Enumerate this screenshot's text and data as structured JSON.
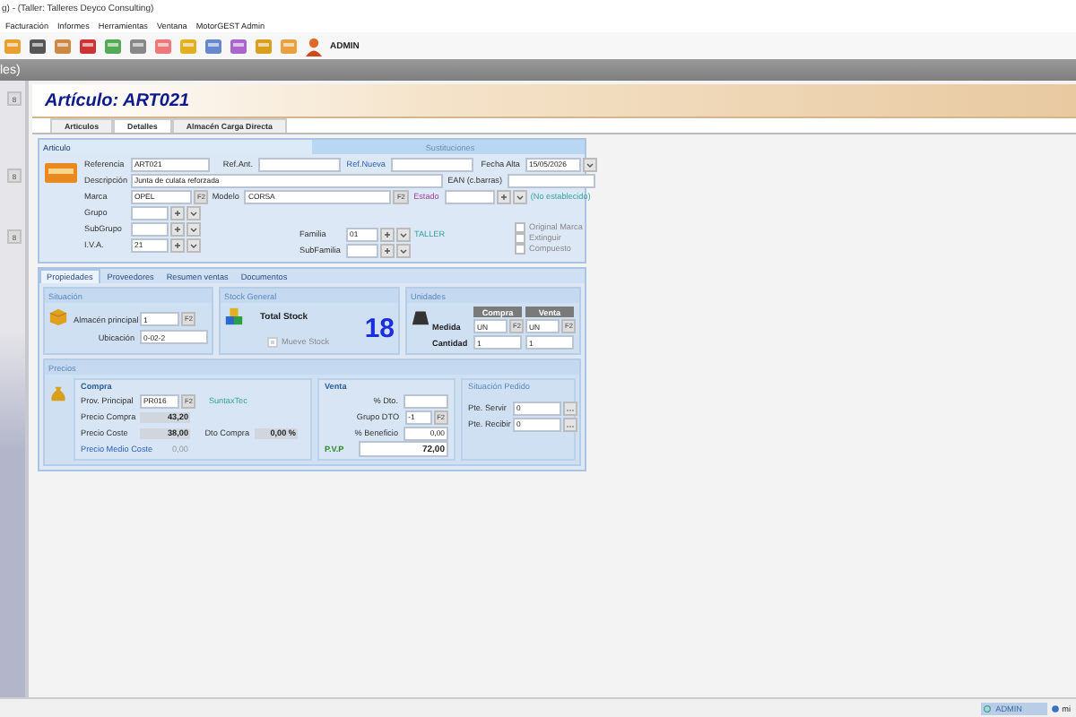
{
  "window": {
    "title": "g) - (Taller: Talleres Deyco Consulting)"
  },
  "menu": [
    "Facturación",
    "Informes",
    "Herramientas",
    "Ventana",
    "MotorGEST Admin"
  ],
  "toolbar": {
    "user": "ADMIN"
  },
  "breadcrumb": "les)",
  "sidebar": {
    "badges": [
      "8",
      "8",
      "8"
    ]
  },
  "header": {
    "title": "Artículo: ART021"
  },
  "tabs": [
    {
      "label": "Articulos",
      "selected": false
    },
    {
      "label": "Detalles",
      "selected": true
    },
    {
      "label": "Almacén Carga Directa",
      "selected": false
    }
  ],
  "articulo": {
    "tabs": [
      {
        "label": "Articulo",
        "selected": true
      },
      {
        "label": "Sustituciones",
        "selected": false
      }
    ],
    "referencia": {
      "label": "Referencia",
      "value": "ART021"
    },
    "ref_ant": {
      "label": "Ref.Ant."
    },
    "ref_nueva": {
      "label": "Ref.Nueva"
    },
    "fecha_alta": {
      "label": "Fecha Alta",
      "value": "15/05/2026"
    },
    "descripcion": {
      "label": "Descripción",
      "value": "Junta de culata reforzada"
    },
    "ean": {
      "label": "EAN (c.barras)"
    },
    "marca": {
      "label": "Marca",
      "value": "OPEL",
      "key": "F2"
    },
    "modelo": {
      "label": "Modelo",
      "value": "CORSA",
      "key": "F2"
    },
    "estado": {
      "label": "Estado",
      "note": "(No establecido)"
    },
    "grupo": {
      "label": "Grupo"
    },
    "subgrupo": {
      "label": "SubGrupo"
    },
    "iva": {
      "label": "I.V.A.",
      "value": "21"
    },
    "familia": {
      "label": "Familia",
      "value": "01",
      "note": "TALLER"
    },
    "subfamilia": {
      "label": "SubFamilia"
    },
    "checks": [
      {
        "label": "Original Marca",
        "checked": false
      },
      {
        "label": "Extinguir",
        "checked": false
      },
      {
        "label": "Compuesto",
        "checked": false
      }
    ]
  },
  "prop_tabs": [
    {
      "label": "Propiedades",
      "selected": true
    },
    {
      "label": "Proveedores",
      "selected": false
    },
    {
      "label": "Resumen ventas",
      "selected": false
    },
    {
      "label": "Documentos",
      "selected": false
    }
  ],
  "situacion": {
    "title": "Situación",
    "almacen": {
      "label": "Almacén principal",
      "value": "1",
      "key": "F2"
    },
    "ubicacion": {
      "label": "Ubicación",
      "value": "0-02-2"
    }
  },
  "stock": {
    "title": "Stock General",
    "label": "Total Stock",
    "value": "18",
    "mueve": {
      "label": "Mueve Stock",
      "checked": true
    }
  },
  "unidades": {
    "title": "Unidades",
    "columns": [
      "Compra",
      "Venta"
    ],
    "medida": {
      "label": "Medida",
      "values": [
        {
          "value": "UN",
          "key": "F2"
        },
        {
          "value": "UN",
          "key": "F2"
        }
      ]
    },
    "cantidad": {
      "label": "Cantidad",
      "values": [
        "1",
        "1"
      ]
    }
  },
  "precios": {
    "title": "Precios",
    "compra": {
      "title": "Compra",
      "prov": {
        "label": "Prov. Principal",
        "value": "PR016",
        "key": "F2",
        "note": "SuntaxTec"
      },
      "precio_compra": {
        "label": "Precio Compra",
        "value": "43,20"
      },
      "precio_coste": {
        "label": "Precio Coste",
        "value": "38,00"
      },
      "dto_compra": {
        "label": "Dto Compra",
        "value": "0,00 %"
      },
      "precio_medio": {
        "label": "Precio Medio Coste",
        "value": "0,00"
      }
    },
    "venta": {
      "title": "Venta",
      "dto": {
        "label": "% Dto."
      },
      "grupo_dto": {
        "label": "Grupo DTO",
        "value": "-1",
        "key": "F2"
      },
      "beneficio": {
        "label": "% Beneficio",
        "value": "0,00"
      },
      "pvp": {
        "label": "P.V.P",
        "value": "72,00"
      }
    },
    "pedido": {
      "title": "Situación Pedido",
      "servir": {
        "label": "Pte. Servir",
        "value": "0"
      },
      "recibir": {
        "label": "Pte. Recibir",
        "value": "0"
      }
    }
  },
  "status_bar": {
    "user": "ADMIN",
    "item": "mi"
  }
}
